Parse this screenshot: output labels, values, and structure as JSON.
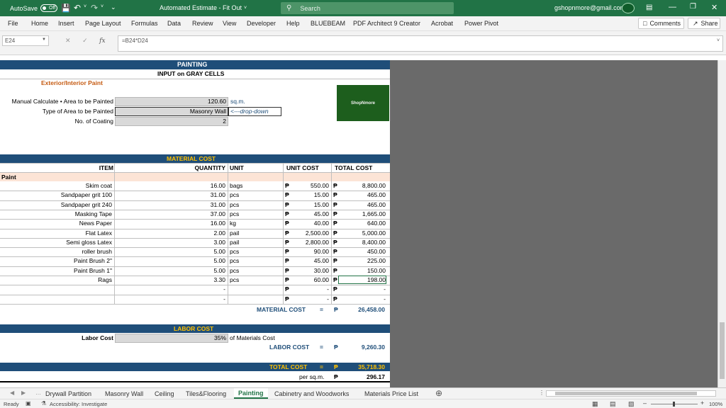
{
  "title_bar": {
    "autosave_label": "AutoSave",
    "autosave_state": "Off",
    "document_title": "Automated Estimate - Fit Out",
    "search_placeholder": "Search",
    "user_email": "gshopnmore@gmail.com"
  },
  "menu": {
    "items": [
      "File",
      "Home",
      "Insert",
      "Page Layout",
      "Formulas",
      "Data",
      "Review",
      "View",
      "Developer",
      "Help",
      "BLUEBEAM",
      "PDF Architect 9 Creator",
      "Acrobat",
      "Power Pivot"
    ],
    "comments_label": "Comments",
    "share_label": "Share"
  },
  "formula_bar": {
    "name_box": "E24",
    "formula": "=B24*D24"
  },
  "sheet": {
    "header_title": "PAINTING",
    "header_subtitle": "INPUT on GRAY CELLS",
    "paint_type_label": "Exterior/Interior Paint",
    "manual_calc_label": "Manual Calculate • Area to be Painted",
    "area_value": "120.60",
    "area_unit": "sq.m.",
    "type_label": "Type of Area to be Painted",
    "type_value": "Masonry Wall",
    "type_hint": "<---drop-down",
    "coating_label": "No. of Coating",
    "coating_value": "2",
    "logo_text": "ShopNmore",
    "material_header": "MATERIAL COST",
    "col_item": "ITEM",
    "col_quantity": "QUANTITY",
    "col_unit": "UNIT",
    "col_unit_cost": "UNIT COST",
    "col_total_cost": "TOTAL COST",
    "category_label": "Paint",
    "currency": "₱",
    "rows": [
      {
        "item": "Skim coat",
        "qty": "16.00",
        "unit": "bags",
        "unit_cost": "550.00",
        "total": "8,800.00"
      },
      {
        "item": "Sandpaper grit 100",
        "qty": "31.00",
        "unit": "pcs",
        "unit_cost": "15.00",
        "total": "465.00"
      },
      {
        "item": "Sandpaper grit 240",
        "qty": "31.00",
        "unit": "pcs",
        "unit_cost": "15.00",
        "total": "465.00"
      },
      {
        "item": "Masking Tape",
        "qty": "37.00",
        "unit": "pcs",
        "unit_cost": "45.00",
        "total": "1,665.00"
      },
      {
        "item": "News Paper",
        "qty": "16.00",
        "unit": "kg",
        "unit_cost": "40.00",
        "total": "640.00"
      },
      {
        "item": "Flat Latex",
        "qty": "2.00",
        "unit": "pail",
        "unit_cost": "2,500.00",
        "total": "5,000.00"
      },
      {
        "item": "Semi gloss Latex",
        "qty": "3.00",
        "unit": "pail",
        "unit_cost": "2,800.00",
        "total": "8,400.00"
      },
      {
        "item": "roller brush",
        "qty": "5.00",
        "unit": "pcs",
        "unit_cost": "90.00",
        "total": "450.00"
      },
      {
        "item": "Paint Brush 2\"",
        "qty": "5.00",
        "unit": "pcs",
        "unit_cost": "45.00",
        "total": "225.00"
      },
      {
        "item": "Paint Brush 1\"",
        "qty": "5.00",
        "unit": "pcs",
        "unit_cost": "30.00",
        "total": "150.00"
      },
      {
        "item": "Rags",
        "qty": "3.30",
        "unit": "pcs",
        "unit_cost": "60.00",
        "total": "198.00"
      },
      {
        "item": "",
        "qty": "-",
        "unit": "",
        "unit_cost": "-",
        "total": "-"
      },
      {
        "item": "",
        "qty": "-",
        "unit": "",
        "unit_cost": "-",
        "total": "-"
      }
    ],
    "material_total_label": "MATERIAL COST",
    "equals": "=",
    "material_total": "26,458.00",
    "labor_header": "LABOR COST",
    "labor_label": "Labor Cost",
    "labor_pct": "35%",
    "labor_of": "of Materials Cost",
    "labor_total_label": "LABOR COST",
    "labor_total": "9,260.30",
    "total_label": "TOTAL COST",
    "total_value": "35,718.30",
    "per_sqm_label": "per sq.m.",
    "per_sqm_value": "296.17"
  },
  "tabs": {
    "items": [
      "Drywall Partition",
      "Masonry Wall",
      "Ceiling",
      "Tiles&Flooring",
      "Painting",
      "Cabinetry and Woodworks",
      "Materials Price List"
    ],
    "active": "Painting"
  },
  "status_bar": {
    "ready": "Ready",
    "accessibility": "Accessibility: Investigate",
    "zoom": "100%"
  },
  "colors": {
    "excel_green": "#217346",
    "band_blue": "#1f4e79",
    "band_yellow": "#ffc000",
    "orange_text": "#c55a11",
    "blue_text": "#1f4e79"
  }
}
